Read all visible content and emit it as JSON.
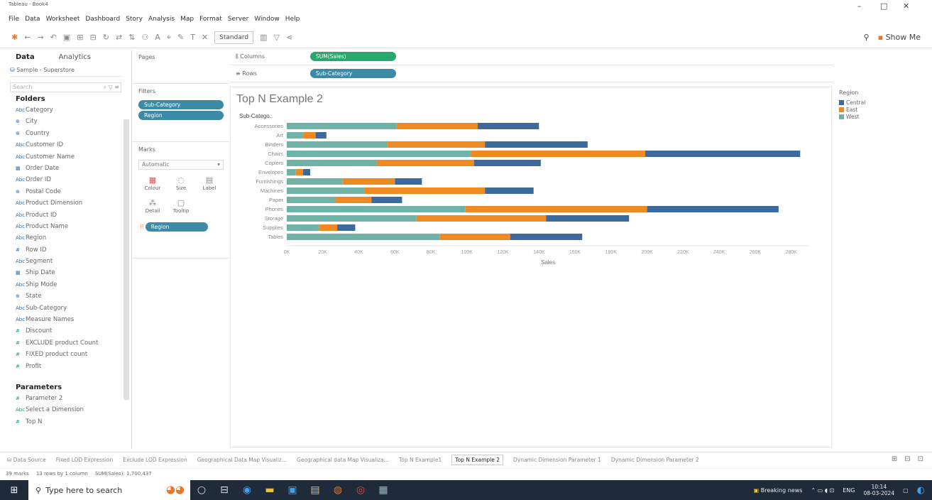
{
  "window": {
    "app_title": "Tableau - Book4",
    "minimize": "–",
    "restore": "□",
    "close": "✕"
  },
  "menu": [
    "File",
    "Data",
    "Worksheet",
    "Dashboard",
    "Story",
    "Analysis",
    "Map",
    "Format",
    "Server",
    "Window",
    "Help"
  ],
  "toolbar": {
    "fit_select": "Standard",
    "show_me": "Show Me"
  },
  "datapane": {
    "tab_data": "Data",
    "tab_analytics": "Analytics",
    "source": "Sample - Superstore",
    "search_placeholder": "Search",
    "folders_heading": "Folders",
    "fields": [
      {
        "name": "Category",
        "type": "dim",
        "icon": "Abc"
      },
      {
        "name": "City",
        "type": "dim",
        "icon": "⊕"
      },
      {
        "name": "Country",
        "type": "dim",
        "icon": "⊕"
      },
      {
        "name": "Customer ID",
        "type": "dim",
        "icon": "Abc"
      },
      {
        "name": "Customer Name",
        "type": "dim",
        "icon": "Abc"
      },
      {
        "name": "Order Date",
        "type": "dim",
        "icon": "▦"
      },
      {
        "name": "Order ID",
        "type": "dim",
        "icon": "Abc"
      },
      {
        "name": "Postal Code",
        "type": "dim",
        "icon": "⊕"
      },
      {
        "name": "Product Dimension",
        "type": "dim",
        "icon": "Abc"
      },
      {
        "name": "Product ID",
        "type": "dim",
        "icon": "Abc"
      },
      {
        "name": "Product Name",
        "type": "dim",
        "icon": "Abc"
      },
      {
        "name": "Region",
        "type": "dim",
        "icon": "Abc"
      },
      {
        "name": "Row ID",
        "type": "dim",
        "icon": "#"
      },
      {
        "name": "Segment",
        "type": "dim",
        "icon": "Abc"
      },
      {
        "name": "Ship Date",
        "type": "dim",
        "icon": "▦"
      },
      {
        "name": "Ship Mode",
        "type": "dim",
        "icon": "Abc"
      },
      {
        "name": "State",
        "type": "dim",
        "icon": "⊕"
      },
      {
        "name": "Sub-Category",
        "type": "dim",
        "icon": "Abc"
      },
      {
        "name": "Measure Names",
        "type": "dim",
        "icon": "Abc"
      },
      {
        "name": "Discount",
        "type": "measure",
        "icon": "#"
      },
      {
        "name": "EXCLUDE product Count",
        "type": "measure",
        "icon": "#"
      },
      {
        "name": "FIXED product count",
        "type": "measure",
        "icon": "#"
      },
      {
        "name": "Profit",
        "type": "measure",
        "icon": "#"
      }
    ],
    "parameters_heading": "Parameters",
    "parameters": [
      {
        "name": "Parameter 2",
        "icon": "#"
      },
      {
        "name": "Select a Dimension",
        "icon": "Abc"
      },
      {
        "name": "Top N",
        "icon": "#"
      }
    ]
  },
  "pages": {
    "title": "Pages"
  },
  "filters": {
    "title": "Filters",
    "pills": [
      "Sub-Category",
      "Region"
    ]
  },
  "marks": {
    "title": "Marks",
    "type": "Automatic",
    "buttons": [
      {
        "label": "Colour",
        "icon": "colour-icon",
        "glyph": "▦"
      },
      {
        "label": "Size",
        "icon": "size-icon",
        "glyph": "◌"
      },
      {
        "label": "Label",
        "icon": "label-icon",
        "glyph": "▤"
      },
      {
        "label": "Detail",
        "icon": "detail-icon",
        "glyph": "⁂"
      },
      {
        "label": "Tooltip",
        "icon": "tooltip-icon",
        "glyph": "▢"
      }
    ],
    "colour_pill": "Region"
  },
  "shelves": {
    "columns_label": "Columns",
    "columns_pill": "SUM(Sales)",
    "rows_label": "Rows",
    "rows_pill": "Sub-Category"
  },
  "view": {
    "title": "Top N Example 2"
  },
  "legend": {
    "title": "Region",
    "items": [
      {
        "name": "Central",
        "color": "#3d6a9e"
      },
      {
        "name": "East",
        "color": "#ef8a22"
      },
      {
        "name": "West",
        "color": "#6fb3a8"
      }
    ]
  },
  "chart_data": {
    "type": "bar",
    "orientation": "horizontal",
    "stacked": true,
    "row_header": "Sub-Catego..",
    "categories": [
      "Accessories",
      "Art",
      "Binders",
      "Chairs",
      "Copiers",
      "Envelopes",
      "Furnishings",
      "Machines",
      "Paper",
      "Phones",
      "Storage",
      "Supplies",
      "Tables"
    ],
    "series": [
      {
        "name": "West",
        "color": "#6fb3a8",
        "values": [
          61000,
          9000,
          56000,
          102000,
          50000,
          5000,
          31000,
          43000,
          27000,
          99000,
          72000,
          18000,
          85000
        ]
      },
      {
        "name": "East",
        "color": "#ef8a22",
        "values": [
          45000,
          7000,
          54000,
          97000,
          54000,
          4000,
          29000,
          67000,
          20000,
          101000,
          72000,
          10000,
          39000
        ]
      },
      {
        "name": "Central",
        "color": "#3d6a9e",
        "values": [
          34000,
          6000,
          57000,
          86000,
          37000,
          4000,
          15000,
          27000,
          17000,
          73000,
          46000,
          10000,
          40000
        ]
      }
    ],
    "xlabel": "Sales",
    "xlim": [
      0,
      290000
    ],
    "xticks": [
      0,
      20000,
      40000,
      60000,
      80000,
      100000,
      120000,
      140000,
      160000,
      180000,
      200000,
      220000,
      240000,
      260000,
      280000
    ],
    "xtick_labels": [
      "0K",
      "20K",
      "40K",
      "60K",
      "80K",
      "100K",
      "120K",
      "140K",
      "160K",
      "180K",
      "200K",
      "220K",
      "240K",
      "260K",
      "280K"
    ]
  },
  "sheet_tabs": {
    "data_source": "Data Source",
    "tabs": [
      "Fixed LOD Expression",
      "Exclude LOD Expression",
      "Geographical Data Map Visualiz...",
      "Geographical data Map Visualiza...",
      "Top N Example1",
      "Top N Example 2",
      "Dynamic Dimension Parameter 1",
      "Dynamic Dimension Parameter 2"
    ],
    "active": "Top N Example 2"
  },
  "status": {
    "marks": "39 marks",
    "rows": "13 rows by 1 column",
    "sum": "SUM(Sales): 1,700,437"
  },
  "taskbar": {
    "search_placeholder": "Type here to search",
    "news": "Breaking news",
    "lang": "ENG",
    "time": "10:14",
    "date": "08-03-2024"
  }
}
